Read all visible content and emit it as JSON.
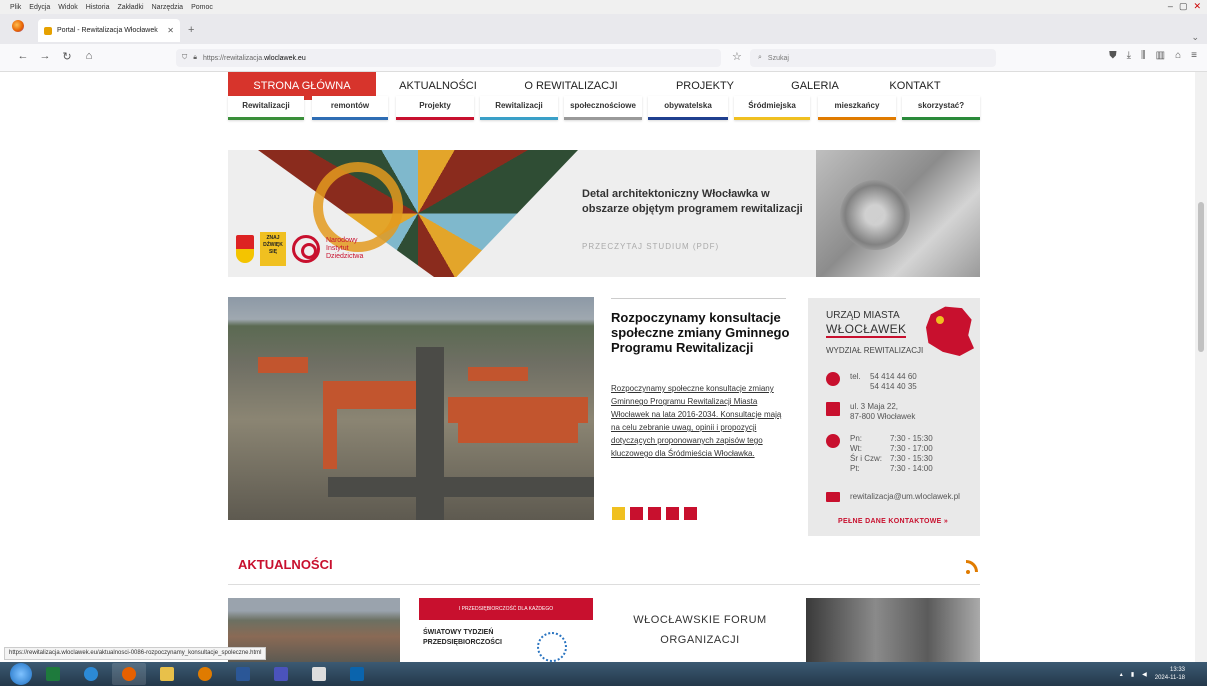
{
  "browser": {
    "menu": [
      "Plik",
      "Edycja",
      "Widok",
      "Historia",
      "Zakładki",
      "Narzędzia",
      "Pomoc"
    ],
    "tab_title": "Portal - Rewitalizacja Włocławek",
    "url_prefix": "https://rewitalizacja.",
    "url_domain": "wloclawek.eu",
    "search_placeholder": "Szukaj"
  },
  "nav": {
    "items": [
      "STRONA GŁÓWNA",
      "AKTUALNOŚCI",
      "O REWITALIZACJI",
      "PROJEKTY",
      "GALERIA",
      "KONTAKT"
    ],
    "sub_items": [
      {
        "label": "Rewitalizacji",
        "color": "#3a8f3a"
      },
      {
        "label": "remontów",
        "color": "#2e6db4"
      },
      {
        "label": "Projekty",
        "color": "#c8102e"
      },
      {
        "label": "Rewitalizacji",
        "color": "#3aa0c8"
      },
      {
        "label": "społecznościowe",
        "color": "#999999"
      },
      {
        "label": "obywatelska",
        "color": "#1f3f8f"
      },
      {
        "label": "Śródmiejska",
        "color": "#f0c020"
      },
      {
        "label": "mieszkańcy",
        "color": "#e07b00"
      },
      {
        "label": "skorzystać?",
        "color": "#2a8a3a"
      }
    ]
  },
  "banner": {
    "text": "Detal architektoniczny Włocławka w obszarze objętym programem rewitalizacji",
    "link": "PRZECZYTAJ STUDIUM (PDF)",
    "logo_text": "Narodowy Instytut Dziedzictwa",
    "logo_yellow": "ZNAJ DŹWIĘK SIĘ"
  },
  "slide": {
    "title": "Rozpoczynamy konsultacje społeczne zmiany Gminnego Programu Rewitalizacji",
    "description": "Rozpoczynamy społeczne konsultacje zmiany Gminnego Programu Rewitalizacji Miasta Włocławek na lata 2016-2034. Konsultacje mają na celu zebranie uwag, opinii i propozycji dotyczących proponowanych zapisów tego kluczowego dla Śródmieścia Włocławka.",
    "dots": 5,
    "active_dot": 0
  },
  "contact": {
    "head1": "URZĄD MIASTA",
    "head2": "WŁOCŁAWEK",
    "dept": "WYDZIAŁ REWITALIZACJI",
    "tel_label": "tel.",
    "tel1": "54 414 44 60",
    "tel2": "54 414 40 35",
    "address1": "ul. 3 Maja 22,",
    "address2": "87-800 Włocławek",
    "hours": [
      {
        "day": "Pn:",
        "time": "7:30 - 15:30"
      },
      {
        "day": "Wt:",
        "time": "7:30 - 17:00"
      },
      {
        "day": "Śr i Czw:",
        "time": "7:30 - 15:30"
      },
      {
        "day": "Pt:",
        "time": "7:30 - 14:00"
      }
    ],
    "email": "rewitalizacja@um.wloclawek.pl",
    "more": "PEŁNE DANE KONTAKTOWE »"
  },
  "news": {
    "heading": "AKTUALNOŚCI",
    "card2_bar": "I PRZEDSIĘBIORCZOŚĆ DLA KAŻDEGO",
    "card2_title": "ŚWIATOWY TYDZIEŃ PRZEDSIĘBIORCZOŚCI",
    "card3_title": "WŁOCŁAWSKIE FORUM ORGANIZACJI"
  },
  "status_url": "https://rewitalizacja.wloclawek.eu/aktualnosci-0086-rozpoczynamy_konsultacje_spoleczne.html",
  "taskbar": {
    "time": "13:33",
    "date": "2024-11-18"
  }
}
